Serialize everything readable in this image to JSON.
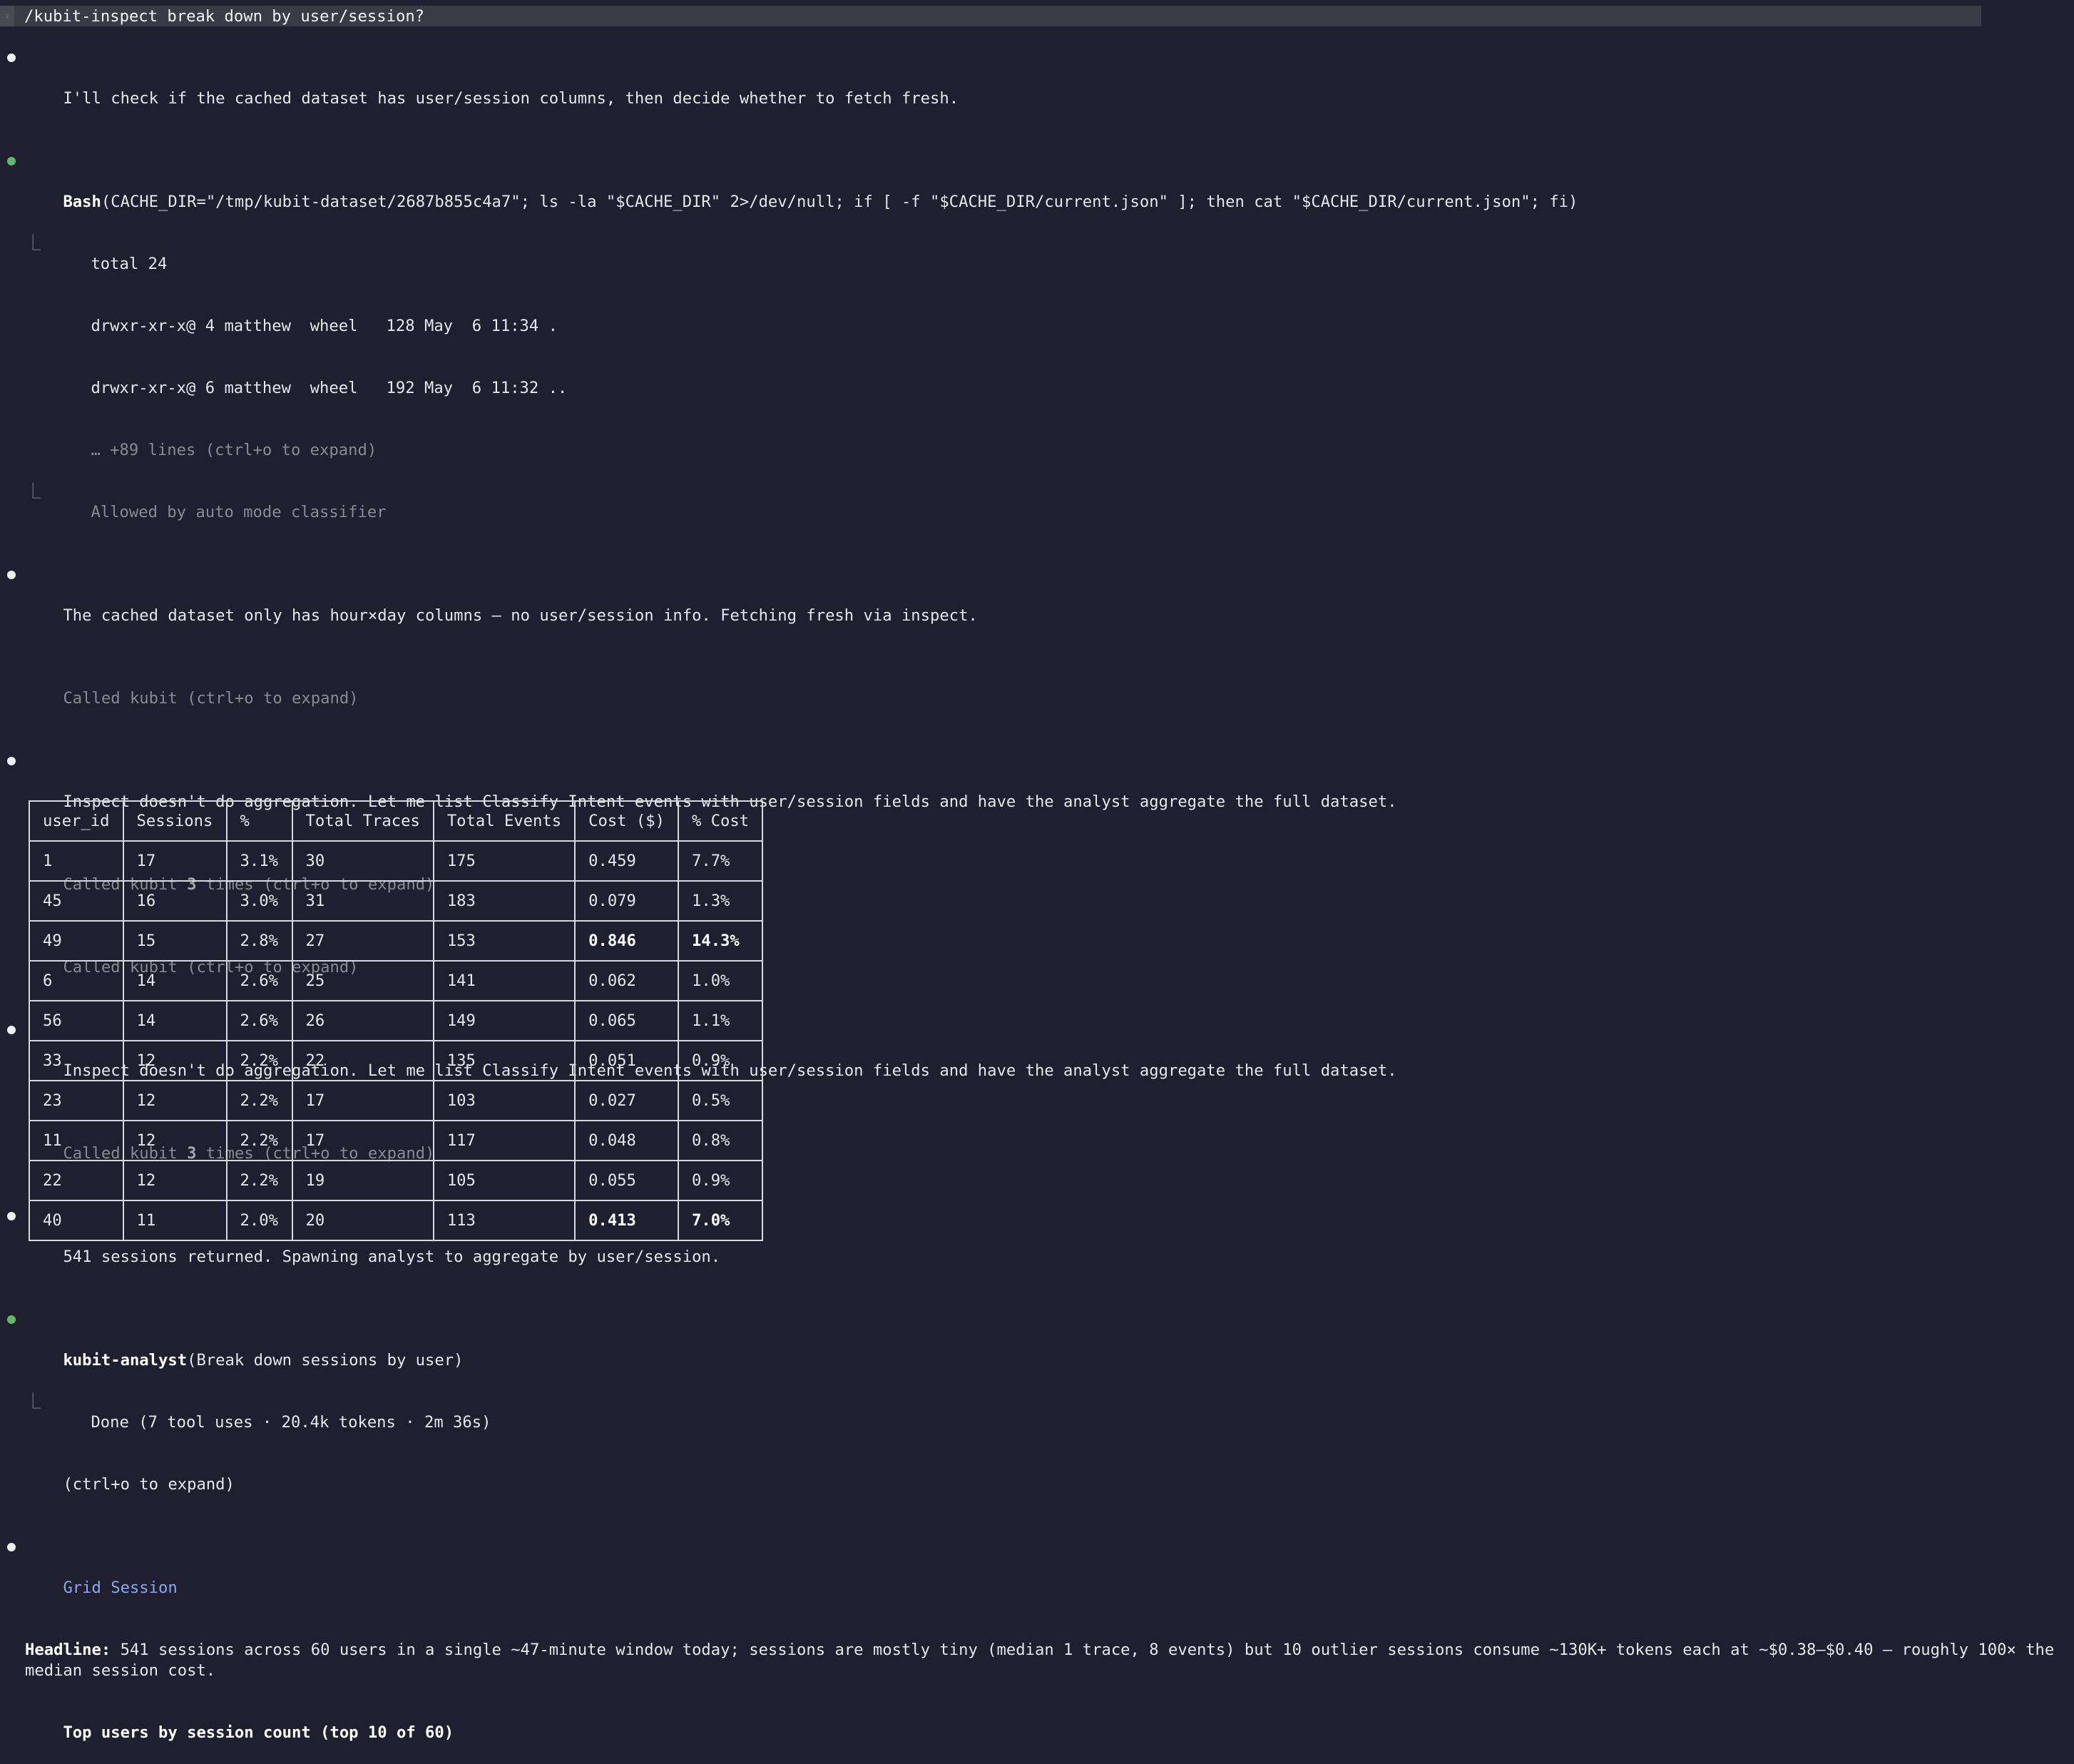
{
  "prompt": {
    "caret": "›",
    "text": "/kubit-inspect break down by user/session?"
  },
  "messages": {
    "m1": "I'll check if the cached dataset has user/session columns, then decide whether to fetch fresh.",
    "bash_tool": "Bash",
    "bash_args": "(CACHE_DIR=\"/tmp/kubit-dataset/2687b855c4a7\"; ls -la \"$CACHE_DIR\" 2>/dev/null; if [ -f \"$CACHE_DIR/current.json\" ]; then cat \"$CACHE_DIR/current.json\"; fi)",
    "bash_out1": "total 24",
    "bash_out2": "drwxr-xr-x@ 4 matthew  wheel   128 May  6 11:34 .",
    "bash_out3": "drwxr-xr-x@ 6 matthew  wheel   192 May  6 11:32 ..",
    "bash_more": "… +89 lines (ctrl+o to expand)",
    "bash_allowed": "Allowed by auto mode classifier",
    "m2": "The cached dataset only has hour×day columns — no user/session info. Fetching fresh via inspect.",
    "called1": "Called kubit (ctrl+o to expand)",
    "m3": "Inspect doesn't do aggregation. Let me list Classify Intent events with user/session fields and have the analyst aggregate the full dataset.",
    "called2_pre": "Called kubit ",
    "called2_count": "3",
    "called2_post": " times (ctrl+o to expand)",
    "called3": "Called kubit (ctrl+o to expand)",
    "m4": "Inspect doesn't do aggregation. Let me list Classify Intent events with user/session fields and have the analyst aggregate the full dataset.",
    "called4_pre": "Called kubit ",
    "called4_count": "3",
    "called4_post": " times (ctrl+o to expand)",
    "m5": "541 sessions returned. Spawning analyst to aggregate by user/session.",
    "agent_tool": "kubit-analyst",
    "agent_args": "(Break down sessions by user)",
    "agent_done": "Done (7 tool uses · 20.4k tokens · 2m 36s)",
    "agent_expand": "(ctrl+o to expand)",
    "grid_session_link": "Grid Session",
    "headline_label": "Headline:",
    "headline_text": " 541 sessions across 60 users in a single ~47-minute window today; sessions are mostly tiny (median 1 trace, 8 events) but 10 outlier sessions consume ~130K+ tokens each at ~$0.38–$0.40 — roughly 100× the median session cost.",
    "top_users_title": "Top users by session count (top 10 of 60)"
  },
  "table": {
    "headers": [
      "user_id",
      "Sessions",
      "%",
      "Total Traces",
      "Total Events",
      "Cost ($)",
      "% Cost"
    ],
    "rows": [
      [
        "1",
        "17",
        "3.1%",
        "30",
        "175",
        "0.459",
        "7.7%"
      ],
      [
        "45",
        "16",
        "3.0%",
        "31",
        "183",
        "0.079",
        "1.3%"
      ],
      [
        "49",
        "15",
        "2.8%",
        "27",
        "153",
        "0.846",
        "14.3%"
      ],
      [
        "6",
        "14",
        "2.6%",
        "25",
        "141",
        "0.062",
        "1.0%"
      ],
      [
        "56",
        "14",
        "2.6%",
        "26",
        "149",
        "0.065",
        "1.1%"
      ],
      [
        "33",
        "12",
        "2.2%",
        "22",
        "135",
        "0.051",
        "0.9%"
      ],
      [
        "23",
        "12",
        "2.2%",
        "17",
        "103",
        "0.027",
        "0.5%"
      ],
      [
        "11",
        "12",
        "2.2%",
        "17",
        "117",
        "0.048",
        "0.8%"
      ],
      [
        "22",
        "12",
        "2.2%",
        "19",
        "105",
        "0.055",
        "0.9%"
      ],
      [
        "40",
        "11",
        "2.0%",
        "20",
        "113",
        "0.413",
        "7.0%"
      ]
    ]
  }
}
